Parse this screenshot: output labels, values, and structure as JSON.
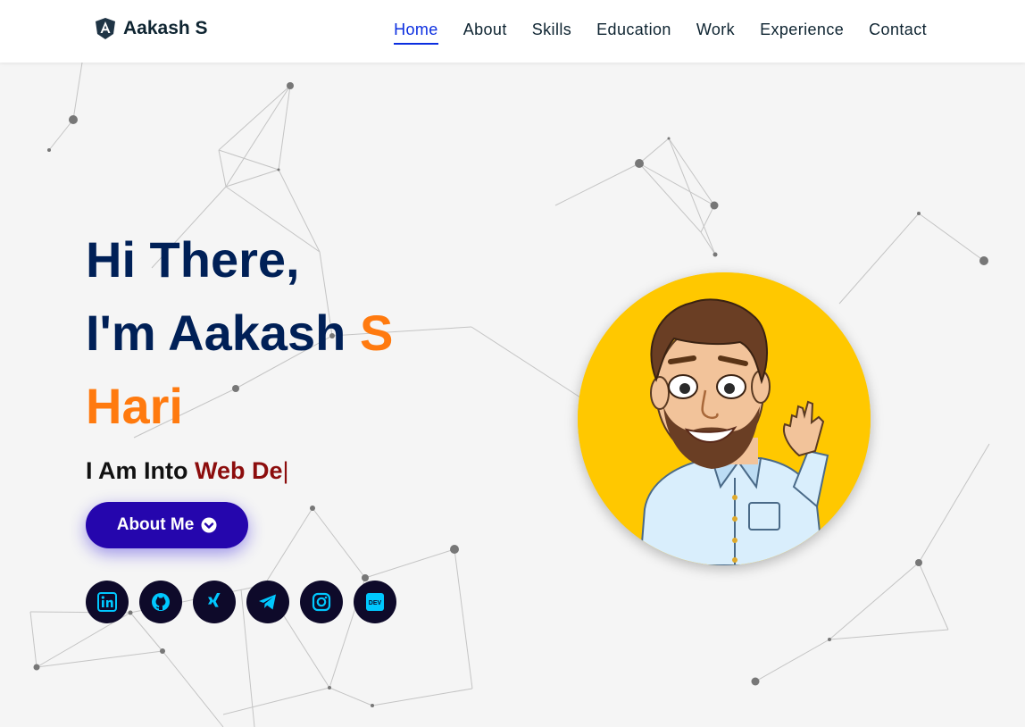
{
  "brand": {
    "name": "Aakash S",
    "icon": "angular-icon"
  },
  "nav": {
    "items": [
      {
        "label": "Home",
        "active": true
      },
      {
        "label": "About",
        "active": false
      },
      {
        "label": "Skills",
        "active": false
      },
      {
        "label": "Education",
        "active": false
      },
      {
        "label": "Work",
        "active": false
      },
      {
        "label": "Experience",
        "active": false
      },
      {
        "label": "Contact",
        "active": false
      }
    ]
  },
  "hero": {
    "greeting": "Hi There,",
    "intro_prefix": "I'm Aakash ",
    "intro_accent": "S",
    "name_line": "Hari",
    "typed_prefix": "I Am Into ",
    "typed_word": "Web De",
    "cursor": "|",
    "button_label": "About Me",
    "button_icon": "arrow-down-circle-icon"
  },
  "socials": [
    {
      "name": "linkedin-icon"
    },
    {
      "name": "github-icon"
    },
    {
      "name": "xing-icon"
    },
    {
      "name": "telegram-icon"
    },
    {
      "name": "instagram-icon"
    },
    {
      "name": "dev-icon",
      "text": "DEV"
    }
  ],
  "colors": {
    "primary": "#002057",
    "accent": "#ff7a0f",
    "typed": "#8c0d0d",
    "button": "#2506ad",
    "nav_active": "#0b2ee0",
    "social_bg": "#0e0a2a",
    "social_icon": "#00c8ff",
    "avatar_bg": "#ffc800"
  }
}
